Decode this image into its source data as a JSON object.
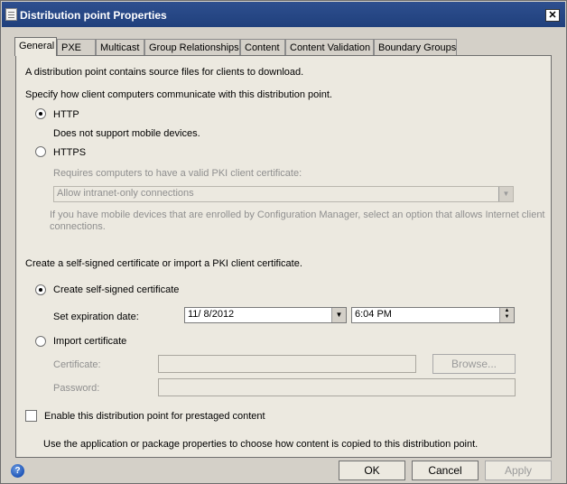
{
  "window": {
    "title": "Distribution point Properties",
    "close_glyph": "✕"
  },
  "tabs": [
    {
      "label": "General",
      "active": true
    },
    {
      "label": "PXE"
    },
    {
      "label": "Multicast"
    },
    {
      "label": "Group Relationships"
    },
    {
      "label": "Content"
    },
    {
      "label": "Content Validation"
    },
    {
      "label": "Boundary Groups"
    }
  ],
  "general": {
    "intro": "A distribution point contains source files for clients to download.",
    "comm_prompt": "Specify how client computers communicate with this distribution point.",
    "http": {
      "label": "HTTP",
      "selected": true,
      "note": "Does not support mobile devices."
    },
    "https": {
      "label": "HTTPS",
      "selected": false,
      "note": "Requires computers to have a valid PKI client certificate:",
      "combo_value": "Allow intranet-only connections",
      "info": "If you have mobile devices that are enrolled by Configuration Manager, select an option that allows Internet client",
      "info_2": "connections."
    },
    "cert_prompt": "Create a self-signed certificate or import a PKI client certificate.",
    "self_signed": {
      "label": "Create self-signed certificate",
      "selected": true,
      "expiration_label": "Set expiration date:",
      "date": "11/  8/2012",
      "time": "6:04 PM"
    },
    "import": {
      "label": "Import certificate",
      "selected": false,
      "certificate_label": "Certificate:",
      "password_label": "Password:",
      "browse_label": "Browse..."
    },
    "prestaged": {
      "label": "Enable this distribution point for prestaged content",
      "checked": false,
      "note": "Use the application or package properties to choose how content is copied to this distribution point."
    }
  },
  "buttons": {
    "ok": "OK",
    "cancel": "Cancel",
    "apply": "Apply"
  },
  "icons": {
    "help": "help-icon",
    "dropdown": "chevron-down-icon",
    "spin": "spin-updown-icon"
  }
}
